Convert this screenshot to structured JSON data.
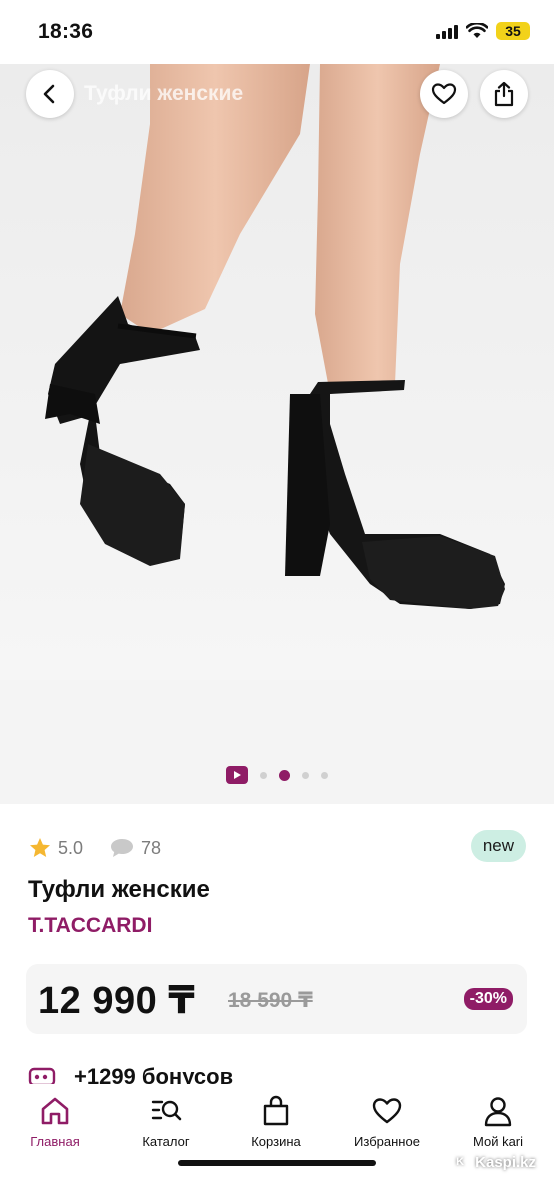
{
  "status_bar": {
    "time": "18:36",
    "battery": "35",
    "icons": [
      "signal-icon",
      "wifi-icon",
      "battery-icon"
    ]
  },
  "header": {
    "title": "Туфли женские",
    "icons": [
      "chevron-left-icon",
      "heart-icon",
      "share-icon"
    ]
  },
  "gallery": {
    "total_slides": 5,
    "active_slide": 3,
    "first_is_video": true
  },
  "product": {
    "rating": "5.0",
    "reviews_count": "78",
    "badge": "new",
    "title": "Туфли женские",
    "brand": "T.TACCARDI",
    "price": "12 990 ₸",
    "old_price": "18 590 ₸",
    "discount": "-30%",
    "bonus": "+1299 бонусов"
  },
  "colors": {
    "accent": "#8f1c66",
    "badge_bg": "#cdeee3",
    "star": "#f5b731"
  },
  "tabs": [
    {
      "label": "Главная",
      "icon": "home-icon",
      "active": true
    },
    {
      "label": "Каталог",
      "icon": "catalog-search-icon",
      "active": false
    },
    {
      "label": "Корзина",
      "icon": "shopping-bag-icon",
      "active": false
    },
    {
      "label": "Избранное",
      "icon": "heart-icon",
      "active": false
    },
    {
      "label": "Мой kari",
      "icon": "user-icon",
      "active": false
    }
  ],
  "watermark": "Kaspi.kz"
}
